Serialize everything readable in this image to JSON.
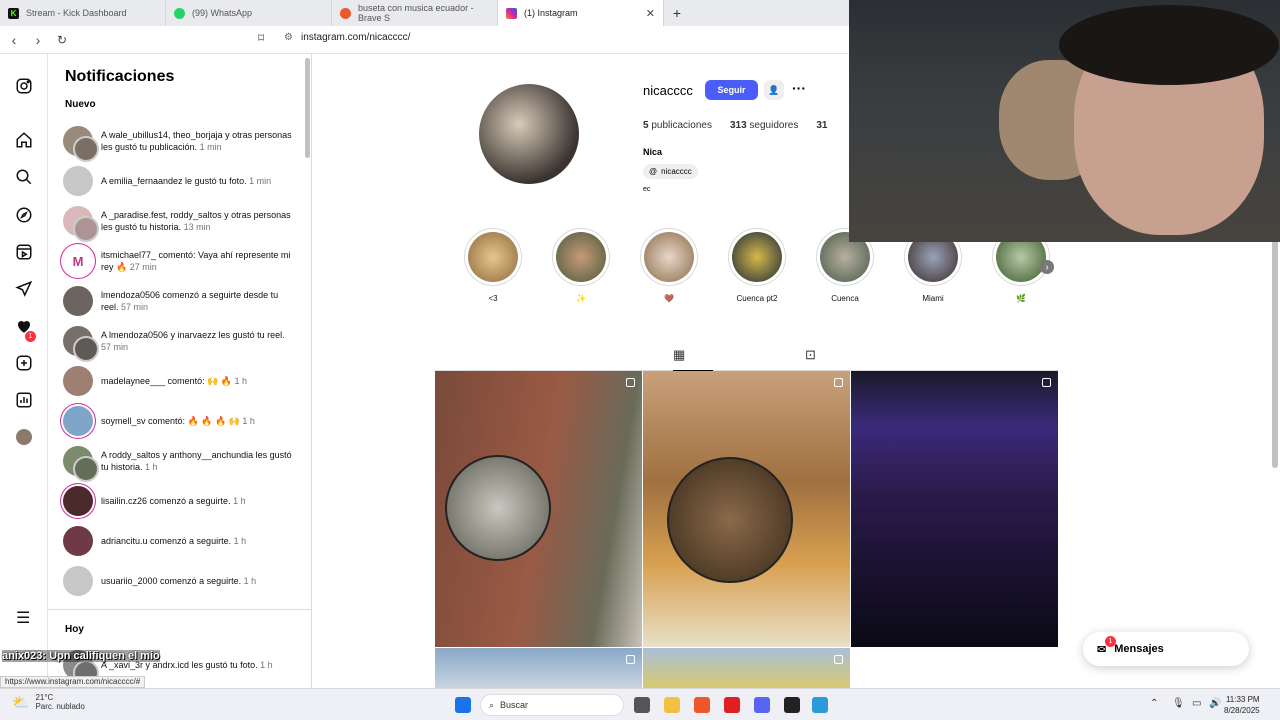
{
  "browser": {
    "tabs": [
      {
        "label": "Stream - Kick Dashboard",
        "icon": "kick-icon",
        "color": "#53fc18",
        "active": false
      },
      {
        "label": "(99) WhatsApp",
        "icon": "whatsapp-icon",
        "color": "#25d366",
        "active": false
      },
      {
        "label": "buseta con musica ecuador - Brave S",
        "icon": "brave-search-icon",
        "color": "#f0562c",
        "active": false
      },
      {
        "label": "(1) Instagram",
        "icon": "instagram-icon",
        "color": "#d6249f",
        "active": true
      }
    ],
    "url": "instagram.com/nicacccc/",
    "status_url": "https://www.instagram.com/nicacccc/#"
  },
  "notifications": {
    "title": "Notificaciones",
    "section_new": "Nuevo",
    "section_today": "Hoy",
    "items": [
      {
        "text": "A wale_ubillus14, theo_borjaja y otras personas les gustó tu publicación.",
        "time": "1 min"
      },
      {
        "text": "A emilia_fernaandez le gustó tu foto.",
        "time": "1 min"
      },
      {
        "text": "A _paradise.fest, roddy_saltos y otras personas les gustó tu historia.",
        "time": "13 min"
      },
      {
        "text": "itsmichael77_ comentó: Vaya ahí represente mi rey 🔥",
        "time": "27 min"
      },
      {
        "text": "lmendoza0506 comenzó a seguirte desde tu reel.",
        "time": "57 min"
      },
      {
        "text": "A lmendoza0506 y inarvaezz les gustó tu reel.",
        "time": "57 min"
      },
      {
        "text": "madelaynee___ comentó: 🙌 🔥",
        "time": "1 h"
      },
      {
        "text": "soymell_sv comentó: 🔥 🔥 🔥 🙌",
        "time": "1 h"
      },
      {
        "text": "A roddy_saltos y anthony__anchundia les gustó tu historia.",
        "time": "1 h"
      },
      {
        "text": "lisailin.cz26 comenzó a seguirte.",
        "time": "1 h"
      },
      {
        "text": "adriancitu.u comenzó a seguirte.",
        "time": "1 h"
      },
      {
        "text": "usuariio_2000 comenzó a seguirte.",
        "time": "1 h"
      }
    ],
    "today_item": {
      "text": "A _xavi_3r y andrx.icd les gustó tu foto.",
      "time": "1 h"
    }
  },
  "profile": {
    "username": "nicacccc",
    "follow_label": "Seguir",
    "posts_count": "5",
    "posts_label": "publicaciones",
    "followers_count": "313",
    "followers_label": "seguidores",
    "following_partial": "31",
    "name": "Nica",
    "threads_handle": "nicacccc",
    "bio": "ec",
    "highlights": [
      "<3",
      "✨",
      "🤎",
      "Cuenca pt2",
      "Cuenca",
      "Miami",
      "🌿"
    ]
  },
  "messages": {
    "label": "Mensajes",
    "badge": "1"
  },
  "overlay_text": "Upn califiquen el mio",
  "overlay_user": "anix023",
  "taskbar": {
    "temp": "21°C",
    "weather": "Parc. nublado",
    "search_placeholder": "Buscar",
    "time": "11:33 PM",
    "date": "8/28/2025"
  },
  "notif_badge": "1"
}
